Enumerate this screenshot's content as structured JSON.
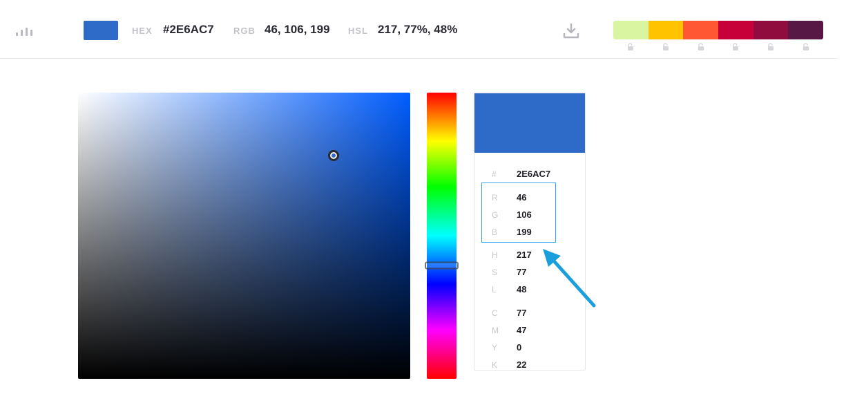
{
  "header": {
    "current_color": "#2E6AC7",
    "hex_label": "HEX",
    "hex_value": "#2E6AC7",
    "rgb_label": "RGB",
    "rgb_value": "46, 106, 199",
    "hsl_label": "HSL",
    "hsl_value": "217, 77%, 48%",
    "icons": {
      "menu": "bars-icon",
      "download": "download-icon",
      "lock": "lock-icon"
    }
  },
  "palette": [
    {
      "color": "#D9F5A1"
    },
    {
      "color": "#FFC300"
    },
    {
      "color": "#FF5733"
    },
    {
      "color": "#C70039"
    },
    {
      "color": "#900C3F"
    },
    {
      "color": "#581845"
    }
  ],
  "picker": {
    "saturation_percent": 77,
    "brightness_percent": 78,
    "hue_degrees": 217
  },
  "details": {
    "swatch_color": "#2E6AC7",
    "rows": [
      {
        "key": "#",
        "value": "2E6AC7"
      },
      {
        "key": "R",
        "value": "46"
      },
      {
        "key": "G",
        "value": "106"
      },
      {
        "key": "B",
        "value": "199"
      },
      {
        "key": "H",
        "value": "217"
      },
      {
        "key": "S",
        "value": "77"
      },
      {
        "key": "L",
        "value": "48"
      },
      {
        "key": "C",
        "value": "77"
      },
      {
        "key": "M",
        "value": "47"
      },
      {
        "key": "Y",
        "value": "0"
      },
      {
        "key": "K",
        "value": "22"
      }
    ]
  },
  "annotation": {
    "highlight_color": "#35A6E8"
  }
}
